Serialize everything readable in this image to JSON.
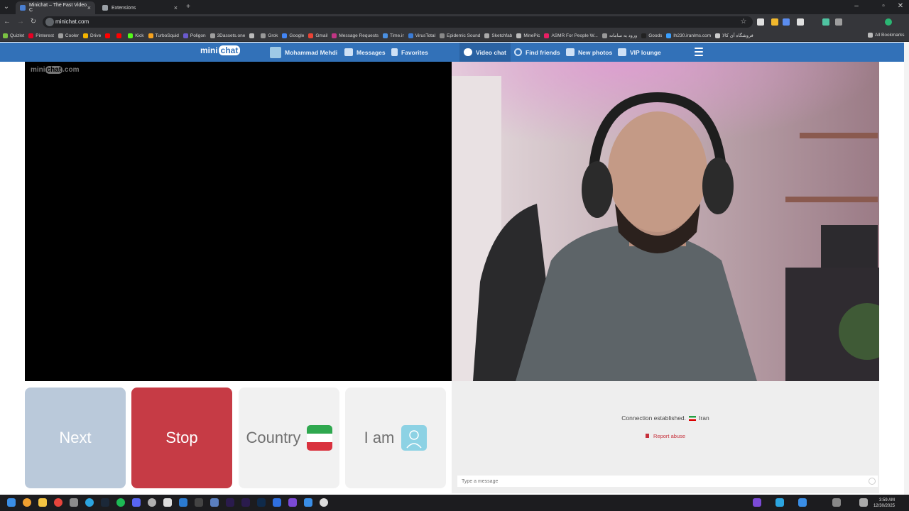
{
  "browser": {
    "tabs": [
      {
        "title": "Minichat – The Fast Video C",
        "active": true
      },
      {
        "title": "Extensions",
        "active": false
      }
    ],
    "url": "minichat.com",
    "bookmarks": [
      "Quizlet",
      "Pinterest",
      "Cooler",
      "Drive",
      "",
      "",
      "Kick",
      "TurboSquid",
      "Poligon",
      "3Dassets.one",
      "",
      "Grok",
      "Google",
      "Gmail",
      "Message Requests",
      "Time.ir",
      "VirusTotal",
      "Epidemic Sound",
      "Sketchfab",
      "MinePic",
      "ASMR For People W...",
      "ورود به سامانه",
      "Goods",
      "lh230.iranlms.com",
      "فروشگاه آی کالا"
    ],
    "all_bookmarks": "All Bookmarks"
  },
  "site": {
    "logo_mini": "mini",
    "logo_chat": "chat",
    "watermark_mini": "mini",
    "watermark_chat": "chat",
    "watermark_com": ".com",
    "nav": {
      "user": "Mohammad Mehdi",
      "messages": "Messages",
      "favorites": "Favorites",
      "video_chat": "Video chat",
      "find_friends": "Find friends",
      "new_photos": "New photos",
      "vip_lounge": "VIP lounge"
    },
    "buttons": {
      "next": "Next",
      "stop": "Stop",
      "country": "Country",
      "iam": "I am"
    },
    "chat": {
      "status": "Connection established.",
      "country": "Iran",
      "report": "Report abuse",
      "placeholder": "Type a message"
    }
  },
  "taskbar": {
    "time": "3:59 AM",
    "date": "12/30/2025"
  },
  "colors": {
    "nav_blue": "#3271b8",
    "next": "#bac9da",
    "stop": "#c63b45"
  }
}
